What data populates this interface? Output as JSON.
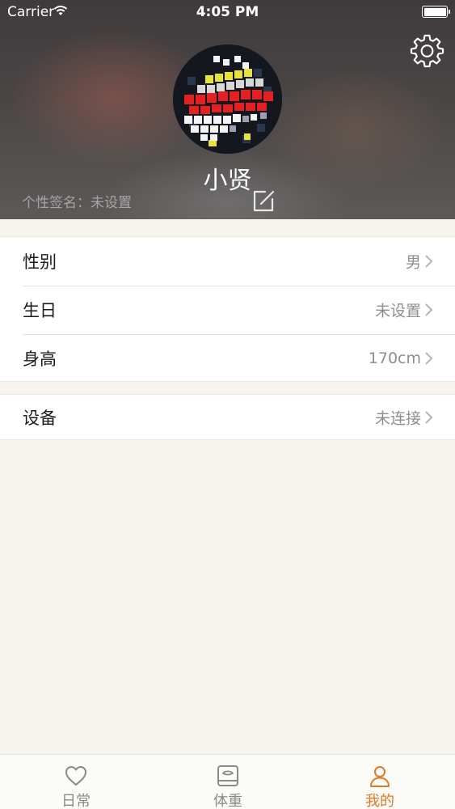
{
  "status_bar": {
    "carrier": "Carrier",
    "time": "4:05 PM"
  },
  "profile": {
    "username": "小贤",
    "signature": "个性签名：未设置"
  },
  "groups": [
    {
      "rows": [
        {
          "label": "性别",
          "value": "男"
        },
        {
          "label": "生日",
          "value": "未设置"
        },
        {
          "label": "身高",
          "value": "170cm"
        }
      ]
    },
    {
      "rows": [
        {
          "label": "设备",
          "value": "未连接"
        }
      ]
    }
  ],
  "tabbar": {
    "tabs": [
      {
        "label": "日常",
        "icon": "heart-icon",
        "active": false
      },
      {
        "label": "体重",
        "icon": "scale-icon",
        "active": false
      },
      {
        "label": "我的",
        "icon": "person-icon",
        "active": true
      }
    ]
  },
  "colors": {
    "accent": "#e07a26",
    "background": "#f6f4ec",
    "tab_inactive": "#8a8a8a"
  }
}
